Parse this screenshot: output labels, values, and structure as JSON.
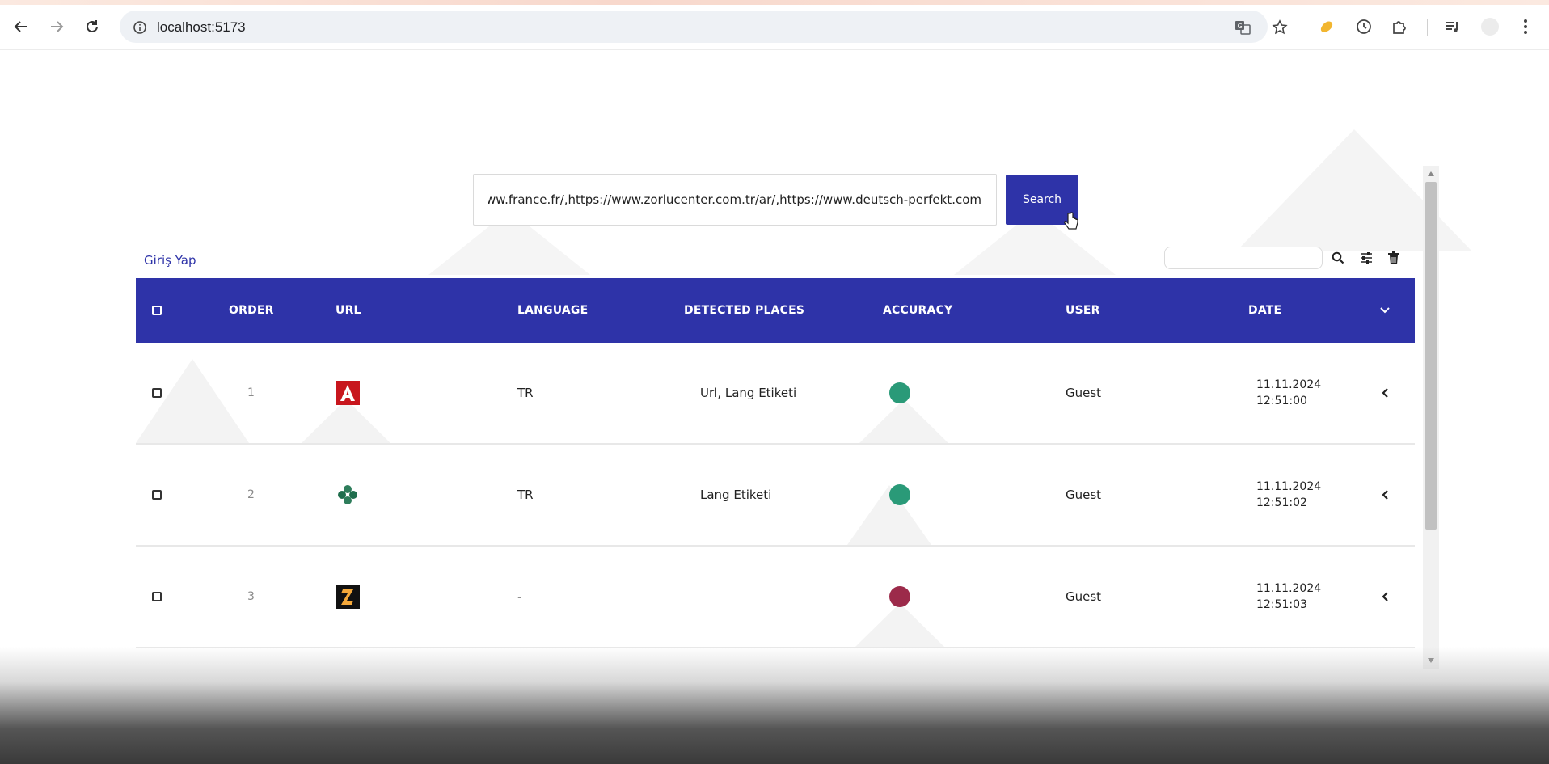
{
  "browser": {
    "url": "localhost:5173",
    "icons": [
      "back-arrow-icon",
      "forward-arrow-icon",
      "reload-icon",
      "site-info-icon",
      "translate-icon",
      "bookmark-star-icon",
      "extension-icon",
      "history-icon",
      "puzzle-icon",
      "media-icon",
      "profile-icon",
      "kebab-menu-icon"
    ]
  },
  "search": {
    "value": "ww.france.fr/,https://www.zorlucenter.com.tr/ar/,https://www.deutsch-perfekt.com/",
    "button_label": "Search"
  },
  "login_label": "Giriş Yap",
  "table": {
    "headers": {
      "order": "ORDER",
      "url": "URL",
      "language": "LANGUAGE",
      "detected_places": "DETECTED PLACES",
      "accuracy": "ACCURACY",
      "user": "USER",
      "date": "DATE"
    },
    "rows": [
      {
        "order": "1",
        "favicon": "red-A-logo",
        "language": "TR",
        "detected_places": "Url, Lang Etiketi",
        "accuracy_color": "#2a9a78",
        "user": "Guest",
        "date": "11.11.2024",
        "time": "12:51:00"
      },
      {
        "order": "2",
        "favicon": "green-clover-logo",
        "language": "TR",
        "detected_places": "Lang Etiketi",
        "accuracy_color": "#2a9a78",
        "user": "Guest",
        "date": "11.11.2024",
        "time": "12:51:02"
      },
      {
        "order": "3",
        "favicon": "black-yellow-Z-logo",
        "language": "-",
        "detected_places": "",
        "accuracy_color": "#9c2a4a",
        "user": "Guest",
        "date": "11.11.2024",
        "time": "12:51:03"
      }
    ]
  },
  "colors": {
    "primary": "#2e33a8",
    "accuracy_good": "#2a9a78",
    "accuracy_bad": "#9c2a4a"
  }
}
